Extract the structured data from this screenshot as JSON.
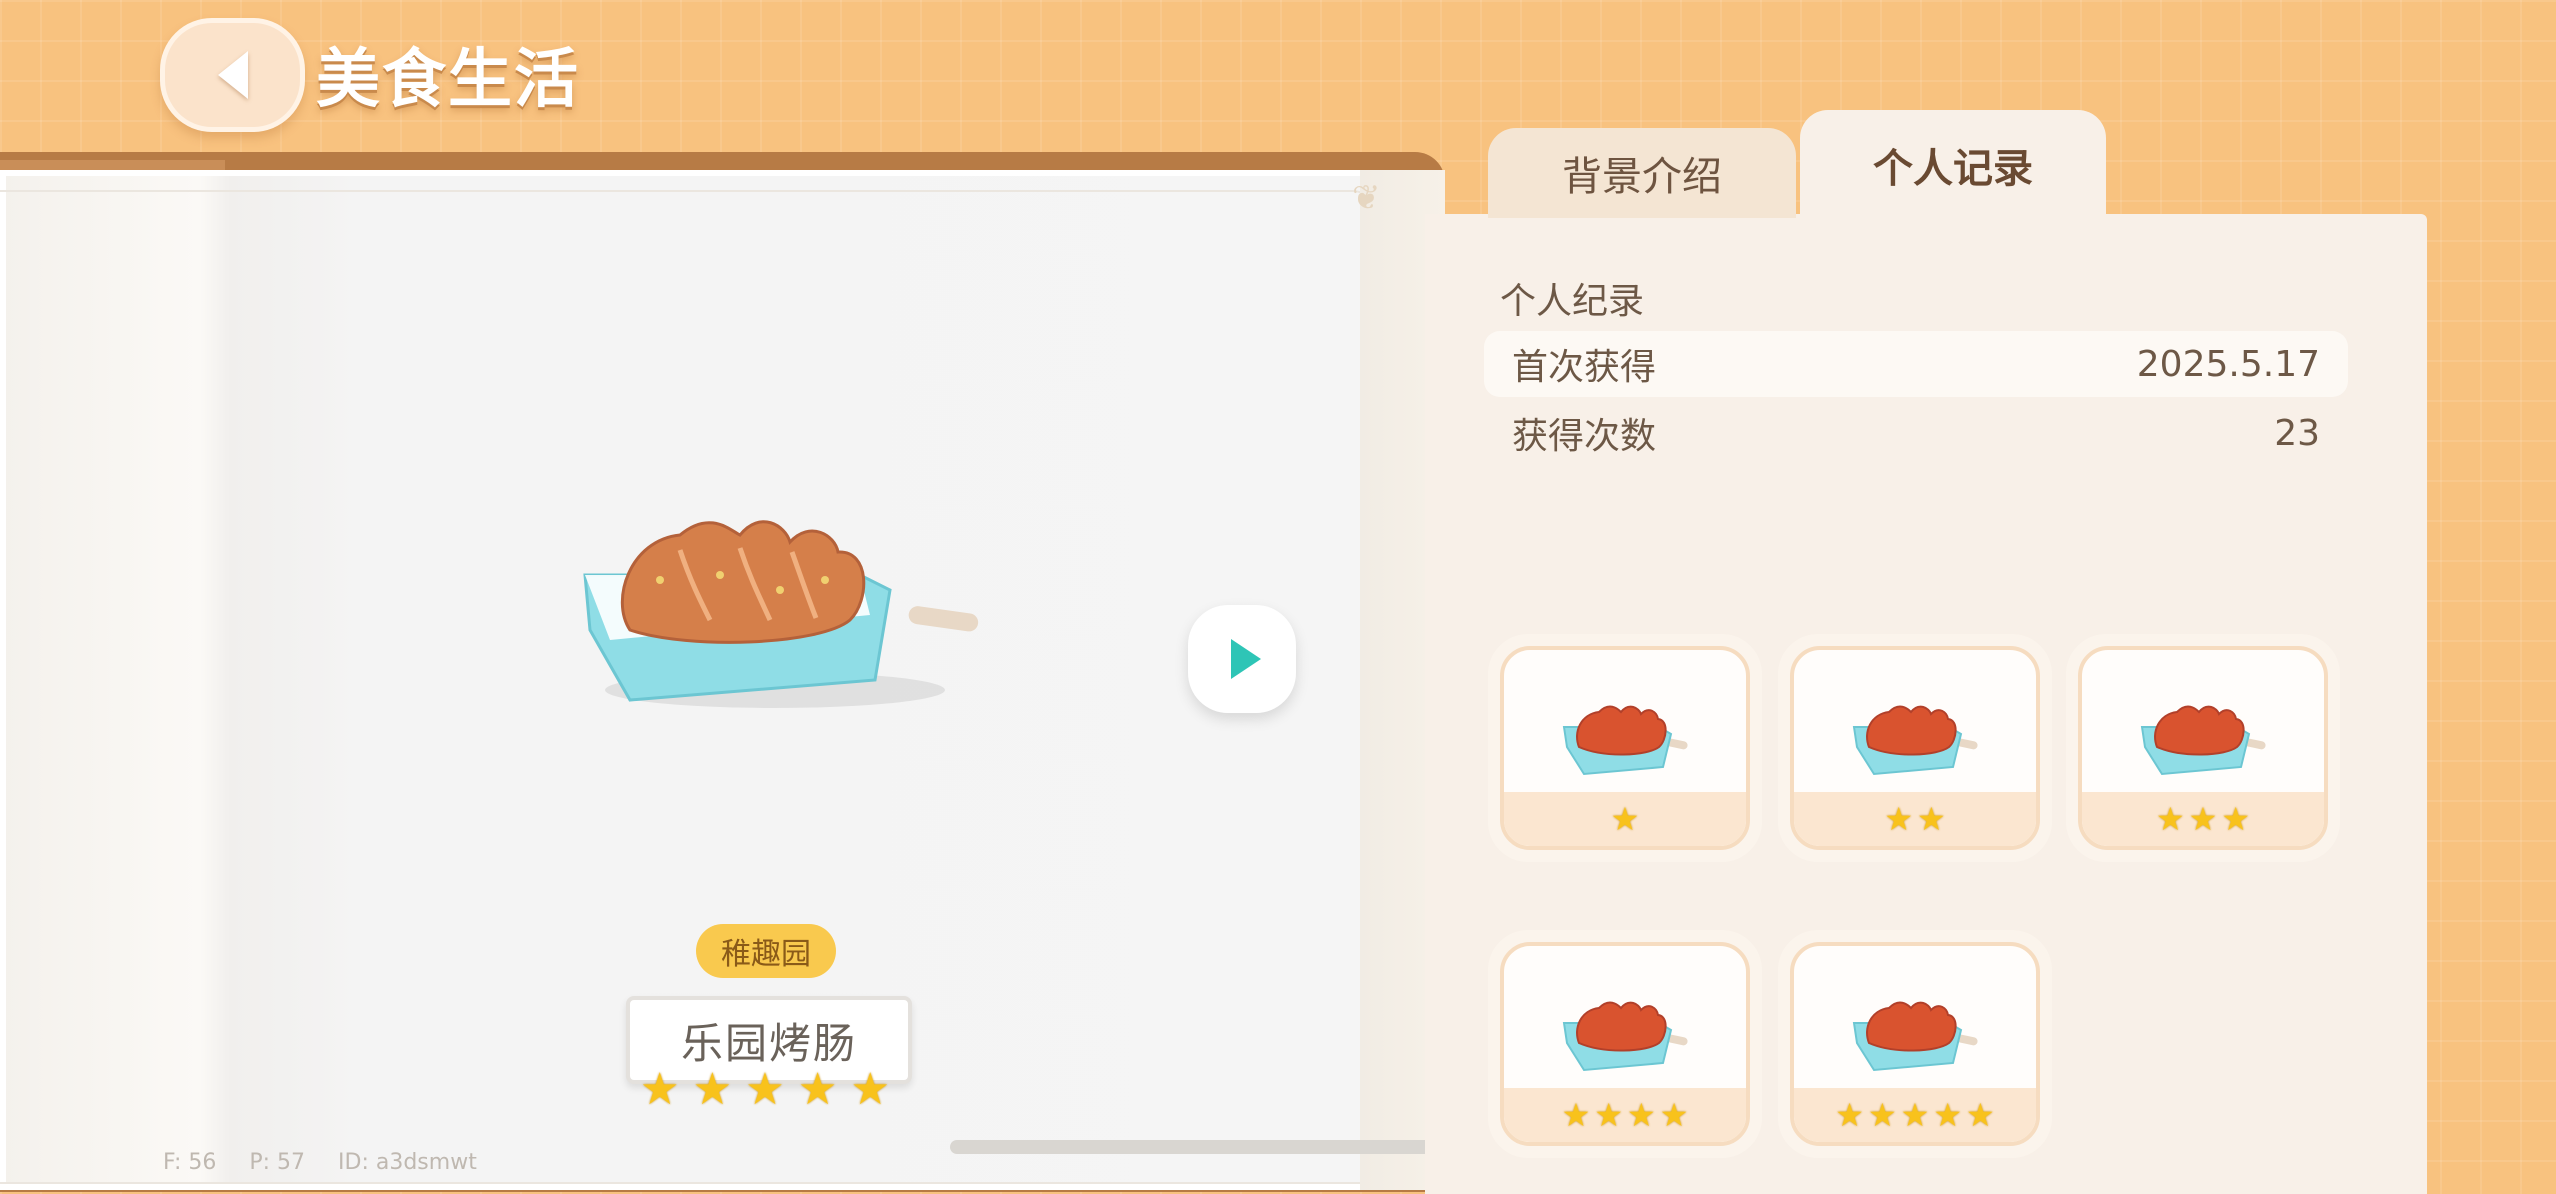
{
  "header": {
    "title": "美食生活",
    "back_icon": "chevron-left-icon"
  },
  "tabs": [
    {
      "label": "背景介绍",
      "active": false
    },
    {
      "label": "个人记录",
      "active": true
    }
  ],
  "food": {
    "region": "稚趣园",
    "name": "乐园烤肠",
    "stars": 5,
    "image": "grilled-sausage-icon"
  },
  "record": {
    "section_title": "个人纪录",
    "first_obtained_label": "首次获得",
    "first_obtained_value": "2025.5.17",
    "count_label": "获得次数",
    "count_value": "23"
  },
  "grades": [
    {
      "stars": 1
    },
    {
      "stars": 2
    },
    {
      "stars": 3
    },
    {
      "stars": 4
    },
    {
      "stars": 5
    }
  ],
  "debug": {
    "f": "F: 56",
    "p": "P: 57",
    "id": "ID: a3dsmwt"
  },
  "colors": {
    "accent": "#2ec5b6",
    "star": "#f8c21c",
    "badge": "#f9c94e",
    "background": "#f8c27f"
  }
}
